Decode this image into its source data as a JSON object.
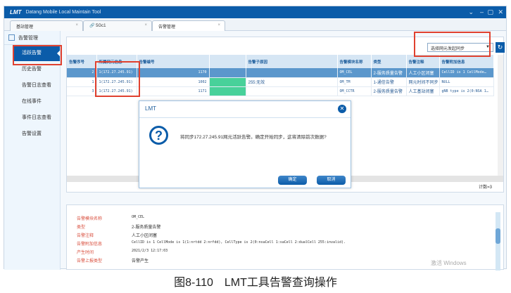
{
  "window": {
    "logo": "LMT",
    "title": "Datang Mobile Local Maintain Tool"
  },
  "tabs": [
    {
      "label": "基站管理"
    },
    {
      "label": "5Gc1"
    },
    {
      "label": "告警管理"
    }
  ],
  "sidebar": {
    "header": "告警管理",
    "items": [
      {
        "label": "活跃告警"
      },
      {
        "label": "历史告警"
      },
      {
        "label": "告警日志查看"
      },
      {
        "label": "在线事件"
      },
      {
        "label": "事件日志查看"
      },
      {
        "label": "告警设置"
      }
    ]
  },
  "toolbar": {
    "sync_select": "选择网元发起同步"
  },
  "table": {
    "headers": [
      "告警序号",
      "所属网元信息",
      "告警编号",
      "",
      "告警子原因",
      "告警模块名称",
      "类型",
      "告警注释",
      "告警附加信息"
    ],
    "rows": [
      [
        "2",
        "1(172.27.245.91)",
        "1170",
        "",
        "",
        "OM_CEL",
        "2-服务质量告警",
        "人工小区闭塞",
        "CellID is 1 CellMode…"
      ],
      [
        "1",
        "1(172.27.245.91)",
        "1002",
        "",
        "255:无效",
        "OM_TM",
        "1-通信告警",
        "网元时间不同步",
        "NULL"
      ],
      [
        "3",
        "1(172.27.245.91)",
        "1171",
        "",
        "",
        "OM_CCTR",
        "2-服务质量告警",
        "人工基站闭塞",
        "gNB type is 2(0:NSA 1…"
      ]
    ],
    "count": "计数=3"
  },
  "detail": [
    {
      "k": "告警模块名称",
      "v": "OM_CEL"
    },
    {
      "k": "类型",
      "v": "2-服务质量告警"
    },
    {
      "k": "告警注释",
      "v": "人工小区闭塞"
    },
    {
      "k": "告警附加信息",
      "v": "CellID is 1 CellMode is 1(1:nrtdd 2:nrfdd), CellType is 2(0:nsaCell 1:saCell 2:dualCell 255:invalid)."
    },
    {
      "k": "产生时间",
      "v": "2021/2/3 12:17:03"
    },
    {
      "k": "告警上报类型",
      "v": "告警产生"
    }
  ],
  "dialog": {
    "title": "LMT",
    "message": "将同步172.27.245.91网元活跃告警。确定开始同步，这将清除前次数据?",
    "ok": "确定",
    "cancel": "取消"
  },
  "watermark": "激活 Windows",
  "caption": "图8-110　LMT工具告警查询操作"
}
